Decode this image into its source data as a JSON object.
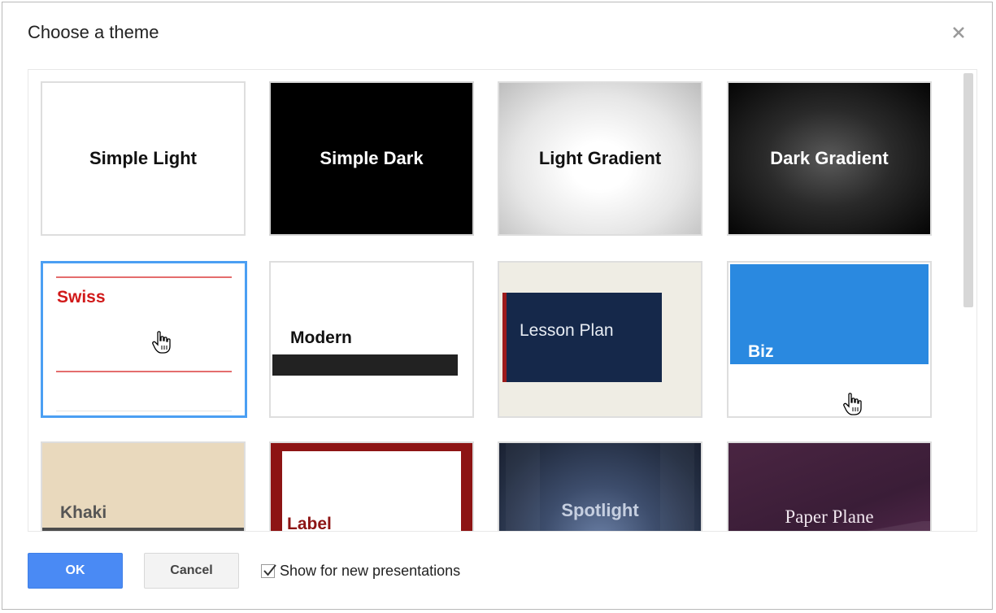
{
  "dialog": {
    "title": "Choose a theme",
    "close_icon": "close-icon"
  },
  "themes": [
    {
      "name": "Simple Light"
    },
    {
      "name": "Simple Dark"
    },
    {
      "name": "Light Gradient"
    },
    {
      "name": "Dark Gradient"
    },
    {
      "name": "Swiss",
      "selected": true
    },
    {
      "name": "Modern"
    },
    {
      "name": "Lesson Plan"
    },
    {
      "name": "Biz"
    },
    {
      "name": "Khaki"
    },
    {
      "name": "Label"
    },
    {
      "name": "Spotlight"
    },
    {
      "name": "Paper Plane"
    }
  ],
  "footer": {
    "ok_label": "OK",
    "cancel_label": "Cancel",
    "show_checkbox_label": "Show for new presentations",
    "show_checkbox_checked": true
  },
  "colors": {
    "selection_border": "#4b9ff3",
    "ok_button": "#4a8af4",
    "swiss_red": "#d11a1a",
    "biz_blue": "#2a89e0",
    "lesson_navy": "#15284a",
    "label_red": "#8d1414"
  }
}
